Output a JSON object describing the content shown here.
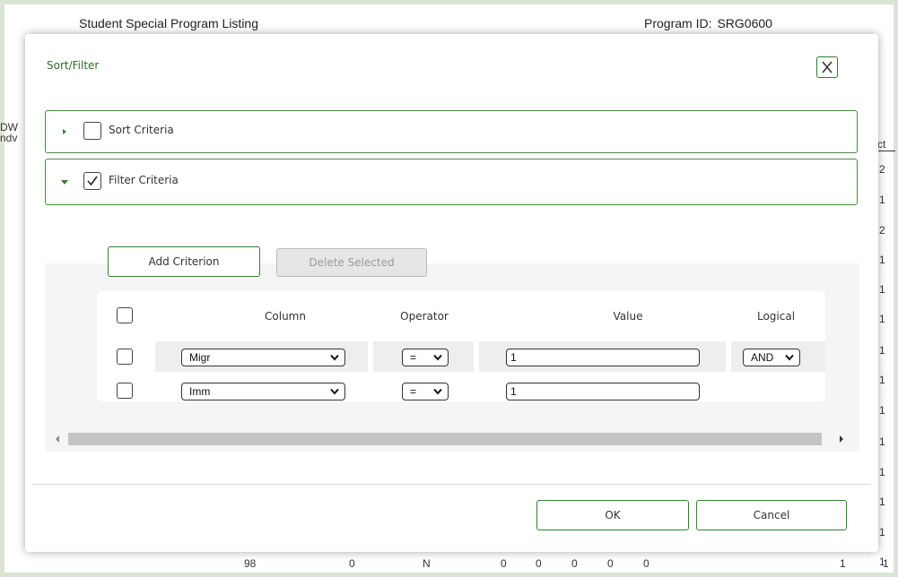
{
  "background": {
    "report_title": "Student Special Program Listing",
    "program_id_label": "Program ID:",
    "program_id_value": "SRG0600",
    "left_fragments": [
      "DW",
      "ndv"
    ],
    "right_header": "ct",
    "right_numbers": [
      "2",
      "1",
      "2",
      "1",
      "1",
      "1",
      "1",
      "1",
      "1",
      "1",
      "1",
      "1",
      "1",
      "1"
    ],
    "bottom_row": [
      "98",
      "0",
      "N",
      "0",
      "0",
      "0",
      "0",
      "0",
      "1",
      "1"
    ]
  },
  "modal": {
    "title": "Sort/Filter",
    "close_label": "X",
    "sort_section": {
      "label": "Sort Criteria",
      "checked": false,
      "expanded": false
    },
    "filter_section": {
      "label": "Filter Criteria",
      "checked": true,
      "expanded": true
    },
    "add_criterion_label": "Add Criterion",
    "delete_selected_label": "Delete Selected",
    "grid": {
      "headers": {
        "column": "Column",
        "operator": "Operator",
        "value": "Value",
        "logical": "Logical"
      },
      "rows": [
        {
          "column": "Migr",
          "operator": "=",
          "value": "1",
          "logical": "AND"
        },
        {
          "column": "Imm",
          "operator": "=",
          "value": "1"
        }
      ]
    },
    "ok_label": "OK",
    "cancel_label": "Cancel"
  },
  "colors": {
    "accent_green": "#3c7d36",
    "outer_frame": "#dbe5d5"
  },
  "icons": [
    "close-icon",
    "caret-right-icon",
    "caret-down-icon",
    "checkmark-icon",
    "chevron-down-icon",
    "scroll-left-icon",
    "scroll-right-icon"
  ]
}
